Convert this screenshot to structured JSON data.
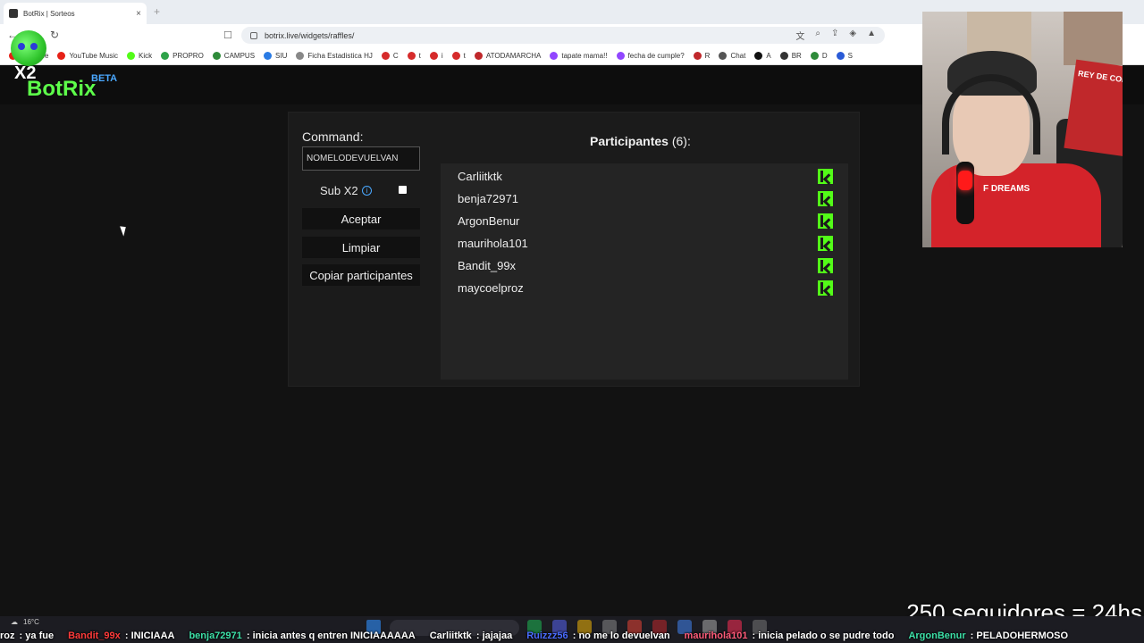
{
  "browser": {
    "tab_title": "BotRix | Sorteos",
    "tab_close": "×",
    "new_tab": "+",
    "url": "botrix.live/widgets/raffles/"
  },
  "bookmarks": [
    {
      "label": "YouTube",
      "color": "#e62117"
    },
    {
      "label": "YouTube Music",
      "color": "#e62117"
    },
    {
      "label": "Kick",
      "color": "#53fc18"
    },
    {
      "label": "PROPRO",
      "color": "#2fa34a"
    },
    {
      "label": "CAMPUS",
      "color": "#2e8b3a"
    },
    {
      "label": "SIU",
      "color": "#2a7be4"
    },
    {
      "label": "Ficha Estadistica HJ",
      "color": "#888888"
    },
    {
      "label": "C",
      "color": "#d62b2b"
    },
    {
      "label": "t",
      "color": "#d62b2b"
    },
    {
      "label": "i",
      "color": "#d62b2b"
    },
    {
      "label": "t",
      "color": "#d62b2b"
    },
    {
      "label": "ATODAMARCHA",
      "color": "#c0282b"
    },
    {
      "label": "tapate mama!!",
      "color": "#9146ff"
    },
    {
      "label": "fecha de cumple?",
      "color": "#9146ff"
    },
    {
      "label": "R",
      "color": "#c0282b"
    },
    {
      "label": "Chat",
      "color": "#555555"
    },
    {
      "label": "A",
      "color": "#111111"
    },
    {
      "label": "BR",
      "color": "#333333"
    },
    {
      "label": "D",
      "color": "#2e8b3a"
    },
    {
      "label": "S",
      "color": "#2a5bd7"
    }
  ],
  "logo": {
    "badge": "X2",
    "name": "BotRix",
    "tag": "BETA"
  },
  "raffle": {
    "command_label": "Command:",
    "command_value": "NOMELODEVUELVAN",
    "sub_label": "Sub X2",
    "info_icon": "i",
    "accept_label": "Aceptar",
    "clear_label": "Limpiar",
    "copy_label": "Copiar participantes",
    "participants_title": "Participantes",
    "participants_count": "(6):",
    "participants": [
      {
        "name": "Carliitktk"
      },
      {
        "name": "benja72971"
      },
      {
        "name": "ArgonBenur"
      },
      {
        "name": "maurihola101"
      },
      {
        "name": "Bandit_99x"
      },
      {
        "name": "maycoelproz"
      }
    ]
  },
  "overlay": {
    "follow_goal": "250 seguidores = 24hs",
    "banner_text": "REY DE COPA",
    "shirt_text": "F DREAMS"
  },
  "taskbar": {
    "temperature": "16°C"
  },
  "chat_ticker": [
    {
      "user": "roz",
      "text": "ya fue",
      "color": "#ffffff"
    },
    {
      "user": "Bandit_99x",
      "text": "INICIAAA",
      "color": "#ff3b3b"
    },
    {
      "user": "benja72971",
      "text": "inicia antes q entren  INICIAAAAAA",
      "color": "#3de0a8"
    },
    {
      "user": "Carliitktk",
      "text": "jajajaa",
      "color": "#ffffff"
    },
    {
      "user": "Ruizzz56",
      "text": "no me lo devuelvan",
      "color": "#4a6cff"
    },
    {
      "user": "maurihola101",
      "text": "inicia pelado o se pudre todo",
      "color": "#ff5c7a"
    },
    {
      "user": "ArgonBenur",
      "text": "PELADOHERMOSO",
      "color": "#3de0a8"
    }
  ]
}
